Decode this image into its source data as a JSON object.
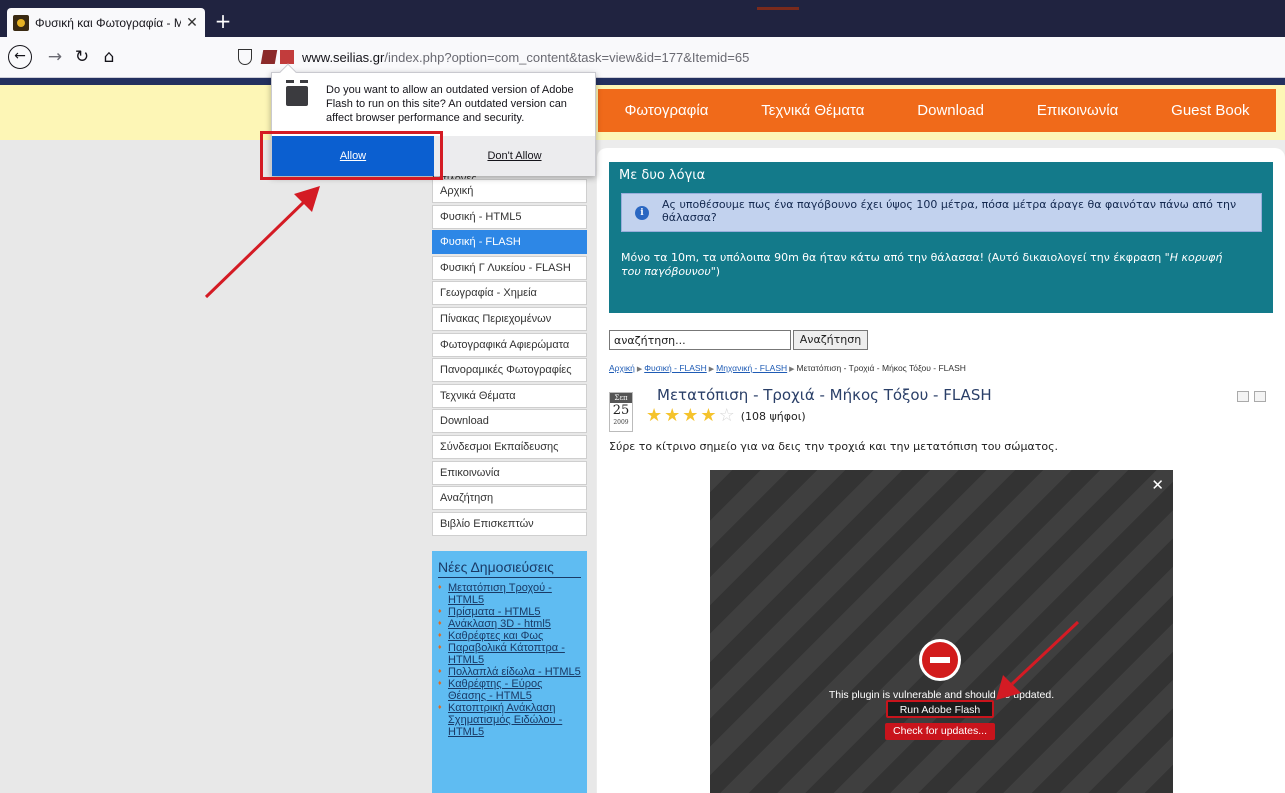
{
  "browser": {
    "tab_title": "Φυσική και Φωτογραφία - Με",
    "tab_close": "✕",
    "new_tab": "+",
    "url_host": "www.seilias.gr",
    "url_path": "/index.php?option=com_content&task=view&id=177&Itemid=65",
    "icons": [
      "back-icon",
      "forward-icon",
      "reload-icon",
      "home-icon",
      "shield-icon",
      "plugin-blocked-icon"
    ]
  },
  "flash_prompt": {
    "message": "Do you want to allow an outdated version of Adobe Flash to run on this site? An outdated version can affect browser performance and security.",
    "allow_label": "Allow",
    "deny_label": "Don't Allow"
  },
  "site_menu": [
    "Φωτογραφία",
    "Τεχνικά Θέματα",
    "Download",
    "Επικοινωνία",
    "Guest Book"
  ],
  "sidebar": {
    "heading": "Επιλογές",
    "items": [
      {
        "label": "Αρχική",
        "active": false
      },
      {
        "label": "Φυσική - HTML5",
        "active": false
      },
      {
        "label": "Φυσική - FLASH",
        "active": true
      },
      {
        "label": "Φυσική Γ Λυκείου - FLASH",
        "active": false
      },
      {
        "label": "Γεωγραφία - Χημεία",
        "active": false
      },
      {
        "label": "Πίνακας Περιεχομένων",
        "active": false
      },
      {
        "label": "Φωτογραφικά Αφιερώματα",
        "active": false
      },
      {
        "label": "Πανοραμικές Φωτογραφίες",
        "active": false
      },
      {
        "label": "Τεχνικά Θέματα",
        "active": false
      },
      {
        "label": "Download",
        "active": false
      },
      {
        "label": "Σύνδεσμοι Εκπαίδευσης",
        "active": false
      },
      {
        "label": "Επικοινωνία",
        "active": false
      },
      {
        "label": "Αναζήτηση",
        "active": false
      },
      {
        "label": "Βιβλίο Επισκεπτών",
        "active": false
      }
    ]
  },
  "new_posts": {
    "title": "Νέες Δημοσιεύσεις",
    "items": [
      "Μετατόπιση Τροχού - HTML5",
      "Πρίσματα - HTML5",
      "Ανάκλαση 3D - html5",
      "Καθρέφτες και Φως",
      "Παραβολικά Κάτοπτρα - HTML5",
      "Πολλαπλά είδωλα - HTML5",
      "Καθρέφτης - Εύρος Θέασης - HTML5",
      "Κατοπτρική Ανάκλαση Σχηματισμός Ειδώλου - HTML5"
    ]
  },
  "quote_box": {
    "title": "Με δυο λόγια",
    "question": "Ας υποθέσουμε πως ένα παγόβουνο έχει ύψος 100 μέτρα, πόσα μέτρα άραγε θα φαινόταν πάνω από την θάλασσα?",
    "answer_prefix": "Μόνο τα 10m, τα υπόλοιπα 90m θα ήταν κάτω από την θάλασσα!  (Αυτό δικαιολογεί την έκφραση \"",
    "answer_italic": "Η κορυφή του παγόβουνου",
    "answer_suffix": "\")"
  },
  "search": {
    "value": "αναζήτηση...",
    "button": "Αναζήτηση"
  },
  "breadcrumb": {
    "links": [
      "Αρχική",
      "Φυσική - FLASH",
      "Μηχανική - FLASH"
    ],
    "current": "Μετατόπιση - Τροχιά - Μήκος Τόξου - FLASH",
    "separator": "▶"
  },
  "article": {
    "date_month": "Σεπ",
    "date_day": "25",
    "date_year": "2009",
    "title": "Μετατόπιση - Τροχιά - Μήκος Τόξου - FLASH",
    "rating_filled": 4,
    "rating_max": 5,
    "votes": "(108 ψήφοι)",
    "description": "Σύρε το κίτρινο σημείο για να δεις την τροχιά και την μετατόπιση του σώματος."
  },
  "flash_plugin": {
    "close": "✕",
    "message": "This plugin is vulnerable and should be updated.",
    "run_label": "Run Adobe Flash",
    "check_label": "Check for updates..."
  },
  "colors": {
    "tabstrip": "#202340",
    "menubar": "#f06a1a",
    "allow_button": "#0b5fd0",
    "annotation_red": "#d41b24",
    "teal_box": "#137a8a",
    "sidebar_active": "#2d87e6",
    "new_posts_bg": "#5fbcf2"
  }
}
